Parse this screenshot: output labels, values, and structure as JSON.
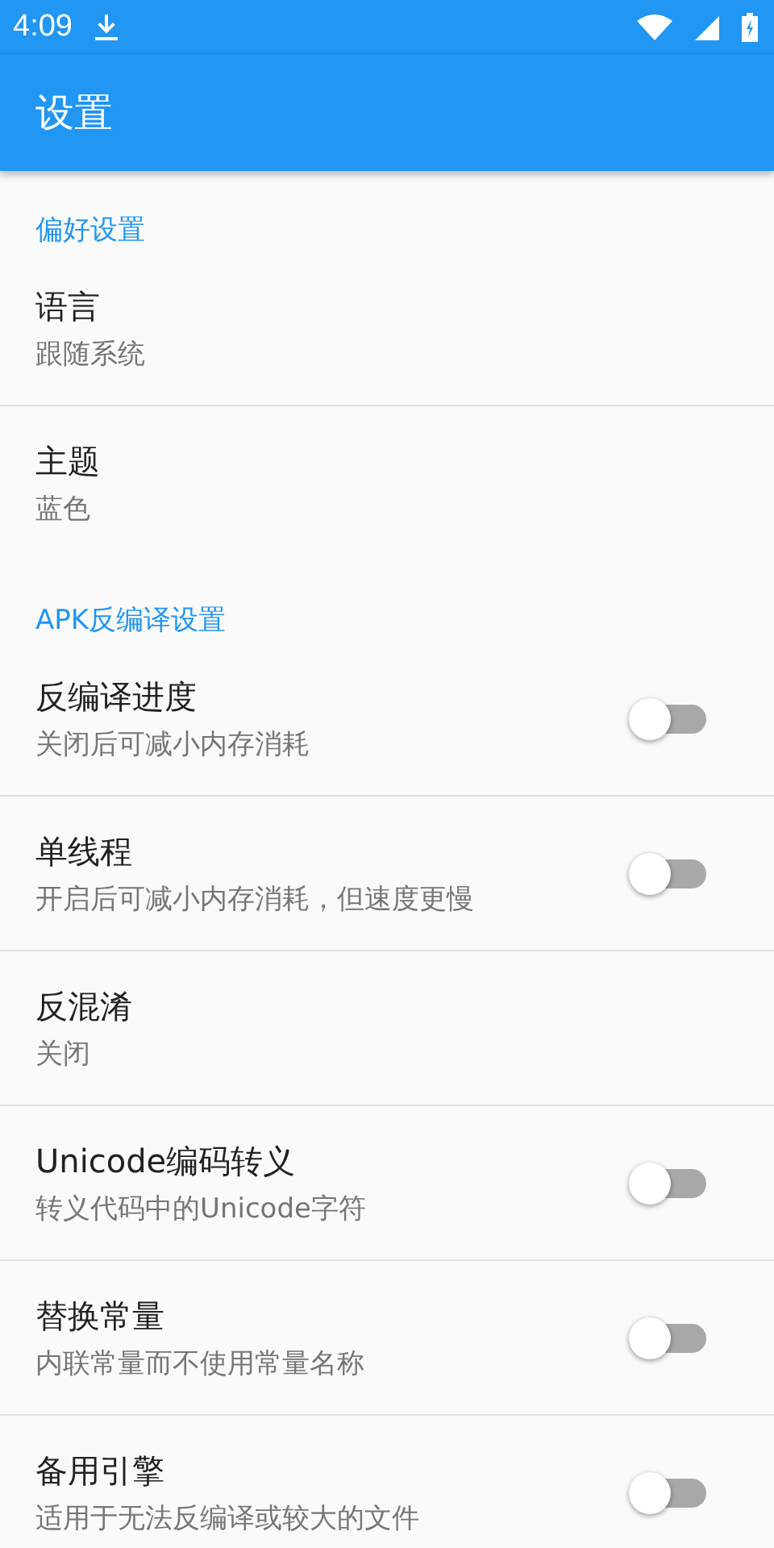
{
  "status_bar": {
    "time": "4:09"
  },
  "toolbar": {
    "title": "设置"
  },
  "sections": [
    {
      "title": "偏好设置",
      "items": [
        {
          "kind": "plain",
          "title": "语言",
          "summary": "跟随系统"
        },
        {
          "kind": "plain",
          "title": "主题",
          "summary": "蓝色"
        }
      ]
    },
    {
      "title": "APK反编译设置",
      "items": [
        {
          "kind": "switch",
          "title": "反编译进度",
          "summary": "关闭后可减小内存消耗",
          "on": false
        },
        {
          "kind": "switch",
          "title": "单线程",
          "summary": "开启后可减小内存消耗，但速度更慢",
          "on": false
        },
        {
          "kind": "plain",
          "title": "反混淆",
          "summary": "关闭"
        },
        {
          "kind": "switch",
          "title": "Unicode编码转义",
          "summary": "转义代码中的Unicode字符",
          "on": false
        },
        {
          "kind": "switch",
          "title": "替换常量",
          "summary": "内联常量而不使用常量名称",
          "on": false
        },
        {
          "kind": "switch",
          "title": "备用引擎",
          "summary": "适用于无法反编译或较大的文件",
          "on": false
        }
      ]
    }
  ]
}
